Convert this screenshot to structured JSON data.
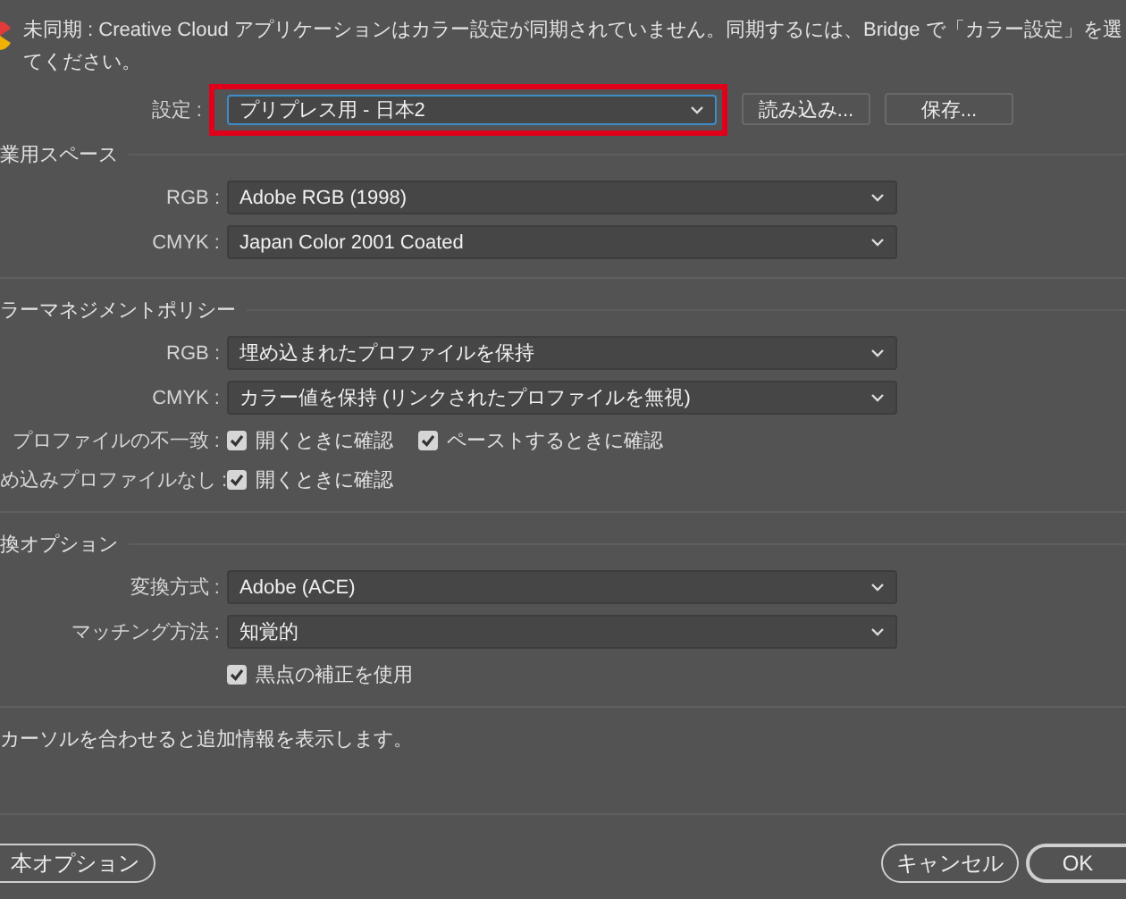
{
  "sync_notice": {
    "lines": [
      "未同期 : Creative Cloud アプリケーションはカラー設定が同期されていません。同期するには、Bridge で「カラー設定」を選",
      "てください。"
    ]
  },
  "settings": {
    "label": "設定 :",
    "value": "プリプレス用 - 日本2",
    "highlighted": true,
    "buttons": [
      "読み込み...",
      "保存..."
    ]
  },
  "sections": [
    {
      "heading": "業用スペース",
      "rows": [
        {
          "kind": "select",
          "label": "RGB :",
          "value": "Adobe RGB (1998)"
        },
        {
          "kind": "select",
          "label": "CMYK :",
          "value": "Japan Color 2001 Coated"
        }
      ]
    },
    {
      "heading": "ラーマネジメントポリシー",
      "rows": [
        {
          "kind": "select",
          "label": "RGB :",
          "value": "埋め込まれたプロファイルを保持"
        },
        {
          "kind": "select",
          "label": "CMYK :",
          "value": "カラー値を保持 (リンクされたプロファイルを無視)"
        },
        {
          "kind": "checks",
          "label": "プロファイルの不一致 :",
          "checks": [
            {
              "label": "開くときに確認",
              "checked": true
            },
            {
              "label": "ペーストするときに確認",
              "checked": true
            }
          ]
        },
        {
          "kind": "checks",
          "label": "め込みプロファイルなし :",
          "checks": [
            {
              "label": "開くときに確認",
              "checked": true
            }
          ]
        }
      ]
    },
    {
      "heading": "換オプション",
      "rows": [
        {
          "kind": "select",
          "label": "変換方式 :",
          "value": "Adobe (ACE)"
        },
        {
          "kind": "select",
          "label": "マッチング方法 :",
          "value": "知覚的"
        },
        {
          "kind": "checks",
          "checks": [
            {
              "label": "黒点の補正を使用",
              "checked": true
            }
          ]
        }
      ]
    }
  ],
  "info": "カーソルを合わせると追加情報を表示します。",
  "footer": {
    "left_button": "本オプション",
    "buttons": [
      "キャンセル",
      "OK"
    ]
  }
}
